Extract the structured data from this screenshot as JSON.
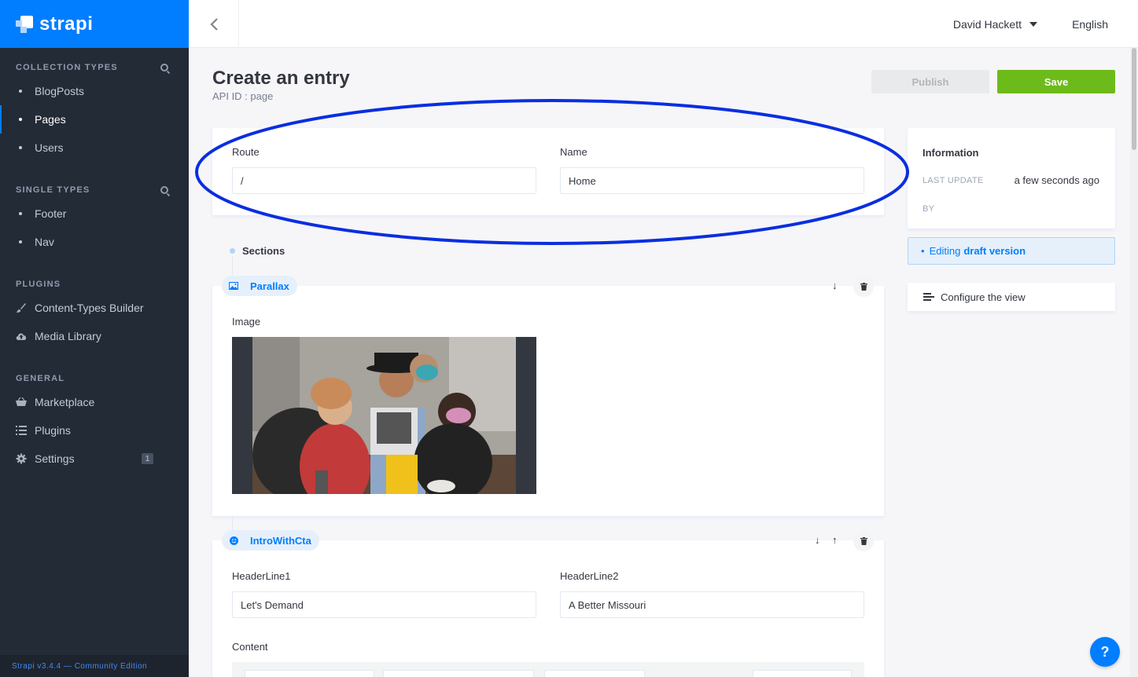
{
  "brand": {
    "name": "strapi"
  },
  "sidebar": {
    "collection_types_title": "Collection Types",
    "collection_types": [
      {
        "label": "BlogPosts",
        "active": false
      },
      {
        "label": "Pages",
        "active": true
      },
      {
        "label": "Users",
        "active": false
      }
    ],
    "single_types_title": "Single Types",
    "single_types": [
      {
        "label": "Footer"
      },
      {
        "label": "Nav"
      }
    ],
    "plugins_title": "Plugins",
    "plugins": [
      {
        "label": "Content-Types Builder",
        "icon": "paintbrush-icon"
      },
      {
        "label": "Media Library",
        "icon": "cloud-upload-icon"
      }
    ],
    "general_title": "General",
    "general": [
      {
        "label": "Marketplace",
        "icon": "basket-icon"
      },
      {
        "label": "Plugins",
        "icon": "list-icon"
      },
      {
        "label": "Settings",
        "icon": "gear-icon",
        "badge": "1"
      }
    ],
    "footer": "Strapi v3.4.4 — Community Edition"
  },
  "header": {
    "user": "David Hackett",
    "language": "English"
  },
  "page": {
    "title": "Create an entry",
    "subtitle": "API ID : page",
    "publish_label": "Publish",
    "save_label": "Save"
  },
  "fields": {
    "route_label": "Route",
    "route_value": "/",
    "name_label": "Name",
    "name_value": "Home"
  },
  "info": {
    "title": "Information",
    "last_update_key": "Last update",
    "last_update_value": "a few seconds ago",
    "by_key": "By",
    "draft_prefix": "Editing",
    "draft_bold": "draft version",
    "configure_label": "Configure the view"
  },
  "sections": {
    "title": "Sections",
    "parallax": {
      "name": "Parallax",
      "image_label": "Image"
    },
    "intro": {
      "name": "IntroWithCta",
      "headerline1_label": "HeaderLine1",
      "headerline1_value": "Let's Demand",
      "headerline2_label": "HeaderLine2",
      "headerline2_value": "A Better Missouri",
      "content_label": "Content"
    }
  },
  "help_label": "?",
  "colors": {
    "brand_blue": "#007eff",
    "save_green": "#6dbb1a",
    "sidebar_bg": "#232b36",
    "annotation_ellipse": "#0a2ee0"
  }
}
